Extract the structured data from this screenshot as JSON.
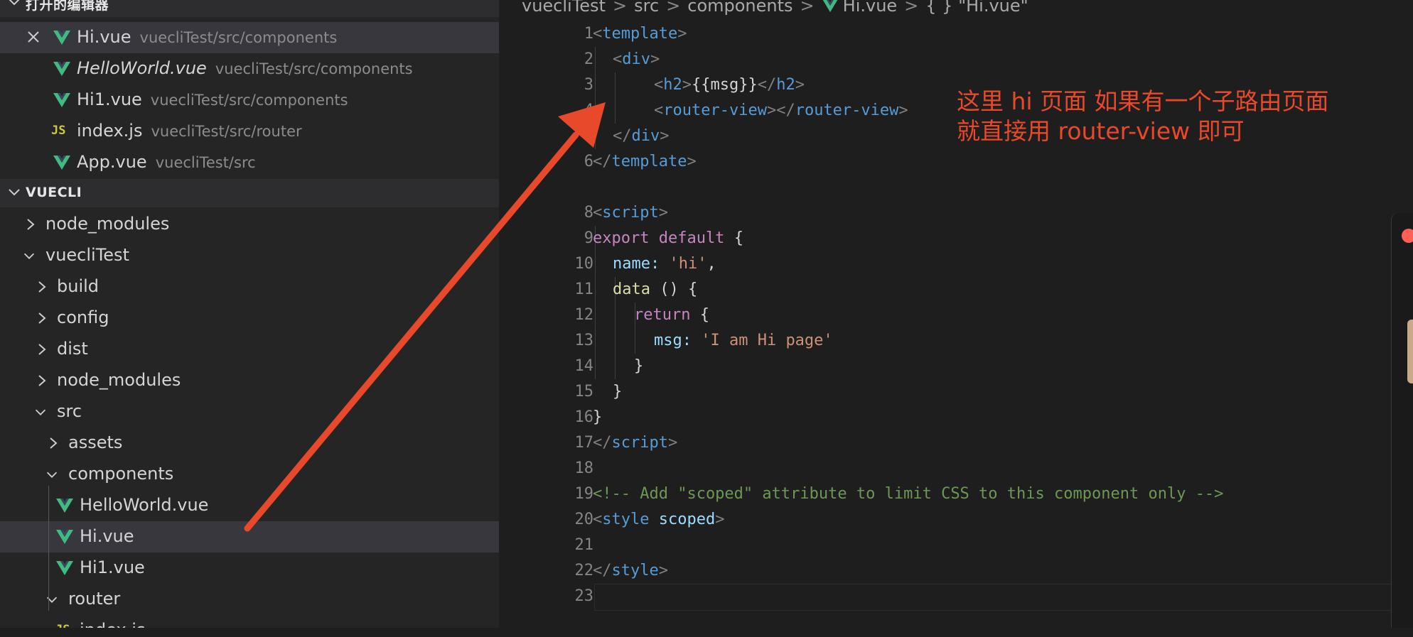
{
  "colors": {
    "vue_green": "#42b883",
    "js_yellow": "#cbcb41",
    "annotation_red": "#e8492b"
  },
  "open_editors": {
    "header": "打开的编辑器",
    "items": [
      {
        "name": "Hi.vue",
        "path": "vuecliTest/src/components",
        "icon": "vue-icon",
        "active": true
      },
      {
        "name": "HelloWorld.vue",
        "path": "vuecliTest/src/components",
        "icon": "vue-icon",
        "italic": true
      },
      {
        "name": "Hi1.vue",
        "path": "vuecliTest/src/components",
        "icon": "vue-icon"
      },
      {
        "name": "index.js",
        "path": "vuecliTest/src/router",
        "icon": "js-icon"
      },
      {
        "name": "App.vue",
        "path": "vuecliTest/src",
        "icon": "vue-icon"
      }
    ]
  },
  "explorer": {
    "header": "VUECLI",
    "tree": [
      {
        "label": "node_modules",
        "expanded": false
      },
      {
        "label": "vuecliTest",
        "expanded": true
      },
      {
        "label": "build",
        "expanded": false
      },
      {
        "label": "config",
        "expanded": false
      },
      {
        "label": "dist",
        "expanded": false
      },
      {
        "label": "node_modules",
        "expanded": false
      },
      {
        "label": "src",
        "expanded": true
      },
      {
        "label": "assets",
        "expanded": false
      },
      {
        "label": "components",
        "expanded": true
      },
      {
        "label": "HelloWorld.vue",
        "icon": "vue-icon"
      },
      {
        "label": "Hi.vue",
        "icon": "vue-icon",
        "selected": true
      },
      {
        "label": "Hi1.vue",
        "icon": "vue-icon"
      },
      {
        "label": "router",
        "expanded": true
      },
      {
        "label": "index.js",
        "icon": "js-icon"
      }
    ]
  },
  "breadcrumb": [
    "vuecliTest",
    "src",
    "components",
    "Hi.vue",
    "{ } \"Hi.vue\""
  ],
  "code": {
    "line_numbers": [
      "1",
      "2",
      "3",
      "4",
      "5",
      "6",
      "8",
      "9",
      "10",
      "11",
      "12",
      "13",
      "14",
      "15",
      "16",
      "17",
      "18",
      "19",
      "20",
      "21",
      "22",
      "23"
    ],
    "t1": "<",
    "t2": "template",
    "t3": ">",
    "t4": "<",
    "t5": "div",
    "t6": ">",
    "t7": "<",
    "t8": "h2",
    "t9": ">",
    "t10": "{{msg}}",
    "t11": "</",
    "t12": "h2",
    "t13": ">",
    "t14": "<",
    "t15": "router-view",
    "t16": "></",
    "t17": "router-view",
    "t18": ">",
    "t19": "</",
    "t20": "div",
    "t21": ">",
    "t22": "</",
    "t23": "template",
    "t24": ">",
    "t25": "<",
    "t26": "script",
    "t27": ">",
    "t28": "export default",
    "t29": "{",
    "t30": "name:",
    "t31": "'hi'",
    "t32": ",",
    "t33": "data",
    "t34": "() {",
    "t35": "return",
    "t36": "{",
    "t37": "msg:",
    "t38": "'I am Hi page'",
    "t39": "}",
    "t40": "}",
    "t41": "}",
    "t42": "</",
    "t43": "script",
    "t44": ">",
    "t45": "<!-- Add \"scoped\" attribute to limit CSS to this component only -->",
    "t46": "<",
    "t47": "style",
    "t48": "scoped",
    "t49": ">",
    "t50": "</",
    "t51": "style",
    "t52": ">"
  },
  "annotation": {
    "line1": "这里 hi 页面 如果有一个子路由页面",
    "line2": "就直接用 router-view 即可"
  }
}
